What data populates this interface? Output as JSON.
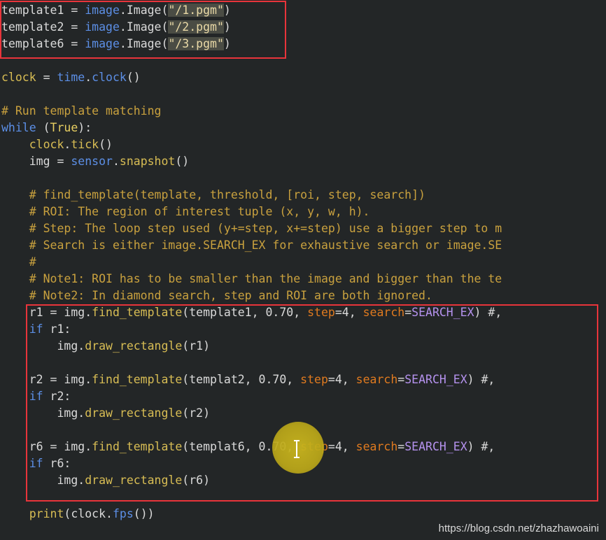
{
  "editor": {
    "lines": [
      {
        "tokens": [
          {
            "text": "template1 = ",
            "cls": "c-default"
          },
          {
            "text": "image",
            "cls": "c-module"
          },
          {
            "text": ".Image(",
            "cls": "c-default"
          },
          {
            "text": "\"/1.pgm\"",
            "cls": "c-string-hl"
          },
          {
            "text": ")",
            "cls": "c-default"
          }
        ]
      },
      {
        "tokens": [
          {
            "text": "template2 = ",
            "cls": "c-default"
          },
          {
            "text": "image",
            "cls": "c-module"
          },
          {
            "text": ".Image(",
            "cls": "c-default"
          },
          {
            "text": "\"/2.pgm\"",
            "cls": "c-string-hl"
          },
          {
            "text": ")",
            "cls": "c-default"
          }
        ]
      },
      {
        "tokens": [
          {
            "text": "template6 = ",
            "cls": "c-default"
          },
          {
            "text": "image",
            "cls": "c-module"
          },
          {
            "text": ".Image(",
            "cls": "c-default"
          },
          {
            "text": "\"/3.pgm\"",
            "cls": "c-string-hl"
          },
          {
            "text": ")",
            "cls": "c-default"
          }
        ]
      },
      {
        "tokens": []
      },
      {
        "tokens": [
          {
            "text": "clock",
            "cls": "c-func"
          },
          {
            "text": " = ",
            "cls": "c-default"
          },
          {
            "text": "time",
            "cls": "c-module"
          },
          {
            "text": ".",
            "cls": "c-default"
          },
          {
            "text": "clock",
            "cls": "c-module"
          },
          {
            "text": "()",
            "cls": "c-default"
          }
        ]
      },
      {
        "tokens": []
      },
      {
        "tokens": [
          {
            "text": "# Run template matching",
            "cls": "c-comment"
          }
        ]
      },
      {
        "tokens": [
          {
            "text": "while",
            "cls": "c-keyword"
          },
          {
            "text": " (",
            "cls": "c-default"
          },
          {
            "text": "True",
            "cls": "c-builtin"
          },
          {
            "text": "):",
            "cls": "c-default"
          }
        ]
      },
      {
        "tokens": [
          {
            "text": "    clock",
            "cls": "c-func"
          },
          {
            "text": ".",
            "cls": "c-default"
          },
          {
            "text": "tick",
            "cls": "c-func"
          },
          {
            "text": "()",
            "cls": "c-default"
          }
        ]
      },
      {
        "tokens": [
          {
            "text": "    img = ",
            "cls": "c-default"
          },
          {
            "text": "sensor",
            "cls": "c-module"
          },
          {
            "text": ".",
            "cls": "c-default"
          },
          {
            "text": "snapshot",
            "cls": "c-func"
          },
          {
            "text": "()",
            "cls": "c-default"
          }
        ]
      },
      {
        "tokens": []
      },
      {
        "tokens": [
          {
            "text": "    # find_template(template, threshold, [roi, step, search])",
            "cls": "c-comment"
          }
        ]
      },
      {
        "tokens": [
          {
            "text": "    # ROI: The region of interest tuple (x, y, w, h).",
            "cls": "c-comment"
          }
        ]
      },
      {
        "tokens": [
          {
            "text": "    # Step: The loop step used (y+=step, x+=step) use a bigger step to m",
            "cls": "c-comment"
          }
        ]
      },
      {
        "tokens": [
          {
            "text": "    # Search is either image.SEARCH_EX for exhaustive search or image.SE",
            "cls": "c-comment"
          }
        ]
      },
      {
        "tokens": [
          {
            "text": "    #",
            "cls": "c-comment"
          }
        ]
      },
      {
        "tokens": [
          {
            "text": "    # Note1: ROI has to be smaller than the image and bigger than the te",
            "cls": "c-comment"
          }
        ]
      },
      {
        "tokens": [
          {
            "text": "    # Note2: In diamond search, step and ROI are both ignored.",
            "cls": "c-comment"
          }
        ]
      },
      {
        "tokens": [
          {
            "text": "    r1 = img.",
            "cls": "c-default"
          },
          {
            "text": "find_template",
            "cls": "c-func"
          },
          {
            "text": "(template1, 0.70, ",
            "cls": "c-default"
          },
          {
            "text": "step",
            "cls": "c-kwarg"
          },
          {
            "text": "=4, ",
            "cls": "c-default"
          },
          {
            "text": "search",
            "cls": "c-kwarg"
          },
          {
            "text": "=",
            "cls": "c-default"
          },
          {
            "text": "SEARCH_EX",
            "cls": "c-const"
          },
          {
            "text": ") #,",
            "cls": "c-default"
          }
        ]
      },
      {
        "tokens": [
          {
            "text": "    ",
            "cls": "c-default"
          },
          {
            "text": "if",
            "cls": "c-keyword"
          },
          {
            "text": " r1:",
            "cls": "c-default"
          }
        ]
      },
      {
        "tokens": [
          {
            "text": "        img.",
            "cls": "c-default"
          },
          {
            "text": "draw_rectangle",
            "cls": "c-func"
          },
          {
            "text": "(r1)",
            "cls": "c-default"
          }
        ]
      },
      {
        "tokens": []
      },
      {
        "tokens": [
          {
            "text": "    r2 = img.",
            "cls": "c-default"
          },
          {
            "text": "find_template",
            "cls": "c-func"
          },
          {
            "text": "(templat2, 0.70, ",
            "cls": "c-default"
          },
          {
            "text": "step",
            "cls": "c-kwarg"
          },
          {
            "text": "=4, ",
            "cls": "c-default"
          },
          {
            "text": "search",
            "cls": "c-kwarg"
          },
          {
            "text": "=",
            "cls": "c-default"
          },
          {
            "text": "SEARCH_EX",
            "cls": "c-const"
          },
          {
            "text": ") #,",
            "cls": "c-default"
          }
        ]
      },
      {
        "tokens": [
          {
            "text": "    ",
            "cls": "c-default"
          },
          {
            "text": "if",
            "cls": "c-keyword"
          },
          {
            "text": " r2:",
            "cls": "c-default"
          }
        ]
      },
      {
        "tokens": [
          {
            "text": "        img.",
            "cls": "c-default"
          },
          {
            "text": "draw_rectangle",
            "cls": "c-func"
          },
          {
            "text": "(r2)",
            "cls": "c-default"
          }
        ]
      },
      {
        "tokens": []
      },
      {
        "tokens": [
          {
            "text": "    r6 = img.",
            "cls": "c-default"
          },
          {
            "text": "find_template",
            "cls": "c-func"
          },
          {
            "text": "(templat6, 0.70, ",
            "cls": "c-default"
          },
          {
            "text": "step",
            "cls": "c-kwarg"
          },
          {
            "text": "=4, ",
            "cls": "c-default"
          },
          {
            "text": "search",
            "cls": "c-kwarg"
          },
          {
            "text": "=",
            "cls": "c-default"
          },
          {
            "text": "SEARCH_EX",
            "cls": "c-const"
          },
          {
            "text": ") #,",
            "cls": "c-default"
          }
        ]
      },
      {
        "tokens": [
          {
            "text": "    ",
            "cls": "c-default"
          },
          {
            "text": "if",
            "cls": "c-keyword"
          },
          {
            "text": " r6:",
            "cls": "c-default"
          }
        ]
      },
      {
        "tokens": [
          {
            "text": "        img.",
            "cls": "c-default"
          },
          {
            "text": "draw_rectangle",
            "cls": "c-func"
          },
          {
            "text": "(r6)",
            "cls": "c-default"
          }
        ]
      },
      {
        "tokens": []
      },
      {
        "tokens": [
          {
            "text": "    ",
            "cls": "c-default"
          },
          {
            "text": "print",
            "cls": "c-func"
          },
          {
            "text": "(clock.",
            "cls": "c-default"
          },
          {
            "text": "fps",
            "cls": "c-module"
          },
          {
            "text": "())",
            "cls": "c-default"
          }
        ]
      }
    ]
  },
  "colors": {
    "background": "#232627",
    "highlight_box": "#e8343b",
    "cursor_halo": "#c9b51e"
  },
  "watermark": {
    "text": "https://blog.csdn.net/zhazhawoaini"
  }
}
